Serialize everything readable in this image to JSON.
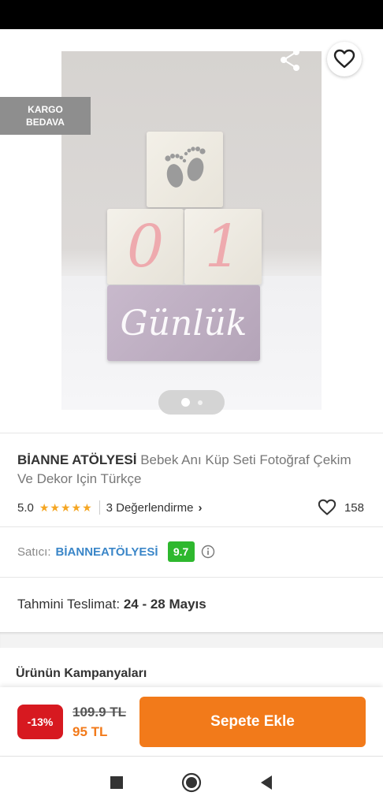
{
  "header": {
    "back_icon": "arrow-left-icon",
    "share_icon": "share-icon",
    "favorite_icon": "heart-outline-icon"
  },
  "badge": {
    "line1": "KARGO",
    "line2": "BEDAVA"
  },
  "gallery": {
    "total_images": 2,
    "active_index": 0
  },
  "product": {
    "brand": "BİANNE ATÖLYESİ",
    "name": "Bebek Anı Küp Seti Fotoğraf Çekim Ve Dekor Için Türkçe",
    "rating": "5.0",
    "stars": "★★★★★",
    "reviews_label": "3 Değerlendirme",
    "favorite_count": "158"
  },
  "photo": {
    "digit_left": "0",
    "digit_right": "1",
    "word": "Günlük"
  },
  "seller": {
    "label": "Satıcı:",
    "name": "BİANNEATÖLYESİ",
    "score": "9.7"
  },
  "delivery": {
    "label": "Tahmini Teslimat:",
    "date": "24 - 28 Mayıs"
  },
  "campaigns": {
    "title": "Ürünün Kampanyaları"
  },
  "pricing": {
    "discount": "-13%",
    "old_price": "109.9 TL",
    "new_price": "95 TL",
    "add_to_cart_label": "Sepete Ekle"
  },
  "colors": {
    "accent": "#f27a1a",
    "discount": "#d71920",
    "seller_score": "#2eb82e",
    "seller_link": "#3a86c8",
    "stars": "#f5a623"
  },
  "navigation": {
    "recents_icon": "square-icon",
    "home_icon": "circle-icon",
    "back_icon": "triangle-back-icon"
  }
}
